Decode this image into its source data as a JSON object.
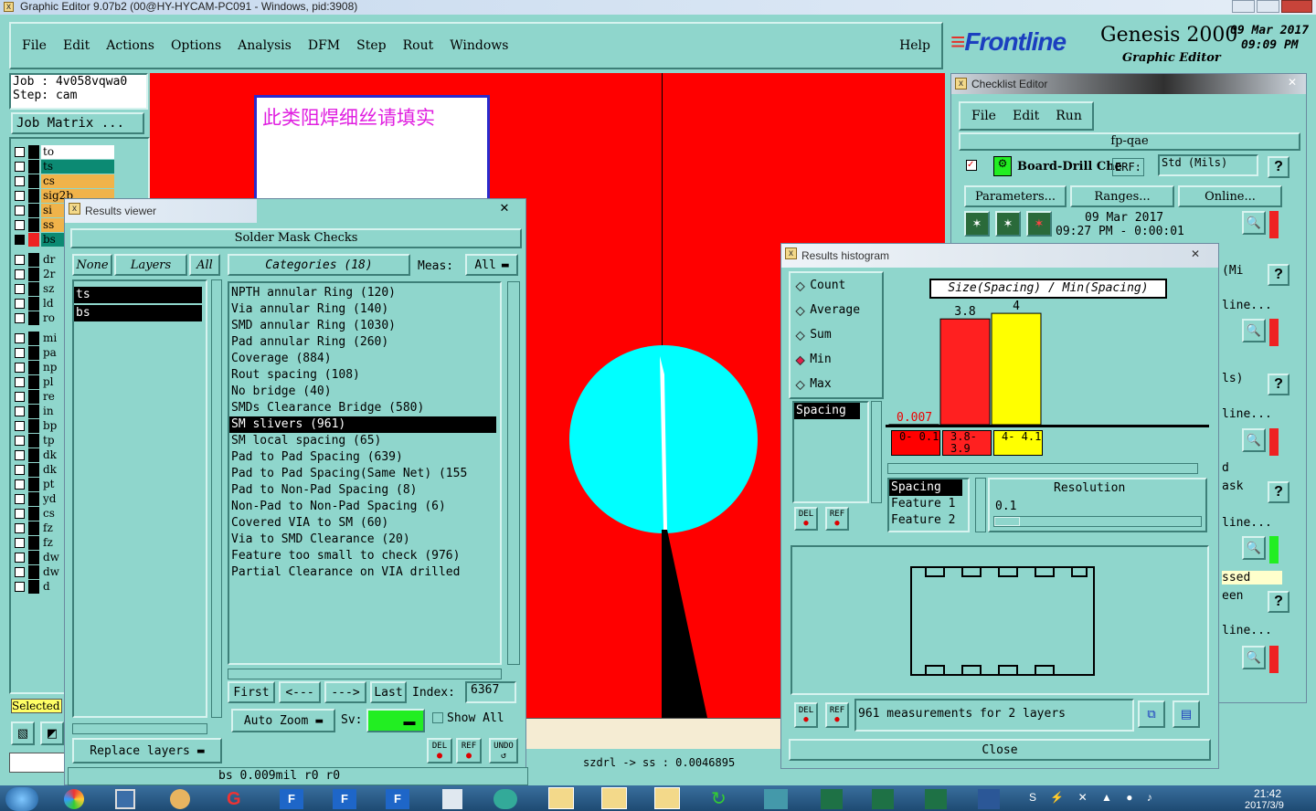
{
  "app": {
    "title": "Graphic Editor 9.07b2 (00@HY-HYCAM-PC091 - Windows, pid:3908)"
  },
  "menu": [
    "File",
    "Edit",
    "Actions",
    "Options",
    "Analysis",
    "DFM",
    "Step",
    "Rout",
    "Windows"
  ],
  "help_label": "Help",
  "brand": {
    "logo": "Frontline",
    "product": "Genesis 2000",
    "subtitle": "Graphic Editor",
    "date": "09 Mar 2017",
    "time": "09:09 PM"
  },
  "job": {
    "job_label": "Job : 4v058vqwa0",
    "step_label": "Step: cam",
    "matrix_button": "Job Matrix ..."
  },
  "layers": [
    {
      "name": "to",
      "color": "#ffffff"
    },
    {
      "name": "ts",
      "color": "#0c8a73"
    },
    {
      "name": "cs",
      "color": "#f0b34a"
    },
    {
      "name": "sig2b",
      "color": "#f0b34a"
    },
    {
      "name": "si",
      "color": "#f0b34a"
    },
    {
      "name": "ss",
      "color": "#f0b34a"
    },
    {
      "name": "bs",
      "color": "#0c8a73"
    },
    {
      "name": "dr",
      "color": "#8fd6cc"
    },
    {
      "name": "2r",
      "color": "#8fd6cc"
    },
    {
      "name": "sz",
      "color": "#8fd6cc"
    },
    {
      "name": "ld",
      "color": "#8fd6cc"
    },
    {
      "name": "ro",
      "color": "#8fd6cc"
    },
    {
      "name": "mi",
      "color": "#8fd6cc"
    },
    {
      "name": "pa",
      "color": "#8fd6cc"
    },
    {
      "name": "np",
      "color": "#8fd6cc"
    },
    {
      "name": "pl",
      "color": "#8fd6cc"
    },
    {
      "name": "re",
      "color": "#8fd6cc"
    },
    {
      "name": "in",
      "color": "#8fd6cc"
    },
    {
      "name": "bp",
      "color": "#8fd6cc"
    },
    {
      "name": "tp",
      "color": "#8fd6cc"
    },
    {
      "name": "dk",
      "color": "#8fd6cc"
    },
    {
      "name": "dk",
      "color": "#8fd6cc"
    },
    {
      "name": "pt",
      "color": "#8fd6cc"
    },
    {
      "name": "yd",
      "color": "#8fd6cc"
    },
    {
      "name": "cs",
      "color": "#8fd6cc"
    },
    {
      "name": "fz",
      "color": "#8fd6cc"
    },
    {
      "name": "fz",
      "color": "#8fd6cc"
    },
    {
      "name": "dw",
      "color": "#8fd6cc"
    },
    {
      "name": "dw",
      "color": "#8fd6cc"
    },
    {
      "name": "d",
      "color": "#8fd6cc"
    }
  ],
  "selected_label": "Selected",
  "note": {
    "text": "此类阻焊细丝请填实"
  },
  "results_viewer": {
    "title": "Results viewer",
    "header": "Solder Mask Checks",
    "none_btn": "None",
    "layers_btn": "Layers",
    "all_btn": "All",
    "categories_btn": "Categories (18)",
    "meas_label": "Meas:",
    "meas_value": "All",
    "layer_list": [
      "ts",
      "bs"
    ],
    "categories": [
      "NPTH annular Ring (120)",
      "Via annular Ring (140)",
      "SMD annular Ring (1030)",
      "Pad annular Ring (260)",
      "Coverage (884)",
      "Rout spacing (108)",
      "No bridge (40)",
      "SMDs Clearance Bridge (580)",
      "SM slivers (961)",
      "SM local spacing (65)",
      "Pad to Pad Spacing (639)",
      "Pad to Pad Spacing(Same Net) (155",
      "Pad to Non-Pad Spacing (8)",
      "Non-Pad to Non-Pad Spacing (6)",
      "Covered VIA to SM (60)",
      "Via to SMD Clearance (20)",
      "Feature too small to check (976)",
      "Partial Clearance on VIA drilled"
    ],
    "selected_index": 8,
    "first_btn": "First",
    "prev_btn": "<---",
    "next_btn": "--->",
    "last_btn": "Last",
    "index_label": "Index:",
    "index_value": "6367",
    "autozoom_btn": "Auto Zoom",
    "sv_label": "Sv:",
    "showall_label": "Show All",
    "replace_btn": "Replace layers",
    "del_btn": "DEL",
    "ref_btn": "REF",
    "undo_btn": "UNDO"
  },
  "status": {
    "left": "bs 0.009mil  r0  r0",
    "right": "szdrl -> ss : 0.0046895"
  },
  "checklist": {
    "title": "Checklist Editor",
    "menu": [
      "File",
      "Edit",
      "Run"
    ],
    "name": "fp-qae",
    "item": "Board-Drill Che",
    "erf": "ERF:",
    "std": "Std (Mils)",
    "params_btn": "Parameters...",
    "ranges_btn": "Ranges...",
    "online_btn": "Online...",
    "date": "09 Mar 2017",
    "elapsed": "09:27 PM - 0:00:01",
    "side_texts": [
      "(Mi",
      "line...",
      "ls)",
      "line...",
      "d",
      "ask",
      "line...",
      "ssed",
      "een",
      "line..."
    ],
    "question": "?"
  },
  "histogram": {
    "title": "Results histogram",
    "options": [
      "Count",
      "Average",
      "Sum",
      "Min",
      "Max"
    ],
    "selected_option": "Min",
    "spacing_item": "Spacing",
    "chart_title": "Size(Spacing) / Min(Spacing)",
    "bars": [
      {
        "range": "0-0.1",
        "value": 0.007,
        "label": "0.007",
        "color": "#ff0000"
      },
      {
        "range": "3.8-3.9",
        "value": 3.8,
        "label": "3.8",
        "color": "#ff2020"
      },
      {
        "range": "4-4.1",
        "value": 4,
        "label": "4",
        "color": "#ffff00"
      }
    ],
    "range_labels": [
      "0- 0.1",
      "3.8- 3.9",
      "4- 4.1"
    ],
    "feature_list": [
      "Spacing",
      "Feature 1",
      "Feature 2"
    ],
    "resolution_label": "Resolution",
    "resolution_value": "0.1",
    "measurements": "961 measurements for 2 layers",
    "close_btn": "Close",
    "del_btn": "DEL",
    "ref_btn": "REF"
  },
  "taskbar": {
    "clock": "21:42",
    "date": "2017/3/9"
  }
}
